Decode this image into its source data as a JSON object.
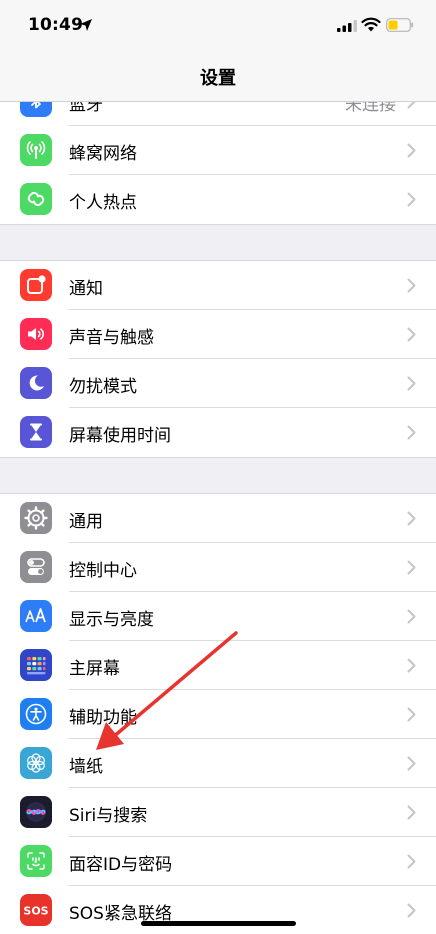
{
  "status": {
    "time": "10:49"
  },
  "nav": {
    "title": "设置"
  },
  "groups": [
    {
      "rows": [
        {
          "label": "蓝牙",
          "value": "未连接",
          "icon": "bluetooth-icon",
          "color": "#2f7df6"
        },
        {
          "label": "蜂窝网络",
          "value": "",
          "icon": "antenna-icon",
          "color": "#4cd964"
        },
        {
          "label": "个人热点",
          "value": "",
          "icon": "hotspot-link-icon",
          "color": "#4cd964"
        }
      ]
    },
    {
      "rows": [
        {
          "label": "通知",
          "icon": "notifications-icon",
          "color": "#ff3b30"
        },
        {
          "label": "声音与触感",
          "icon": "speaker-icon",
          "color": "#ff2d55"
        },
        {
          "label": "勿扰模式",
          "icon": "moon-icon",
          "color": "#5856d6"
        },
        {
          "label": "屏幕使用时间",
          "icon": "hourglass-icon",
          "color": "#5856d6"
        }
      ]
    },
    {
      "rows": [
        {
          "label": "通用",
          "icon": "gear-icon",
          "color": "#8e8e93"
        },
        {
          "label": "控制中心",
          "icon": "toggles-icon",
          "color": "#8e8e93"
        },
        {
          "label": "显示与亮度",
          "icon": "text-size-icon",
          "color": "#2f7df6"
        },
        {
          "label": "主屏幕",
          "icon": "home-grid-icon",
          "color": "#2f46c9"
        },
        {
          "label": "辅助功能",
          "icon": "accessibility-icon",
          "color": "#1f7ff0"
        },
        {
          "label": "墙纸",
          "icon": "flower-icon",
          "color": "#3aa6d6"
        },
        {
          "label": "Siri与搜索",
          "icon": "siri-icon",
          "color": "#1b1b2e"
        },
        {
          "label": "面容ID与密码",
          "icon": "face-id-icon",
          "color": "#4cd964"
        },
        {
          "label": "SOS紧急联络",
          "icon": "sos-icon",
          "color": "#e8332a"
        }
      ]
    }
  ],
  "colors": {
    "annotation_arrow": "#e8342e"
  }
}
